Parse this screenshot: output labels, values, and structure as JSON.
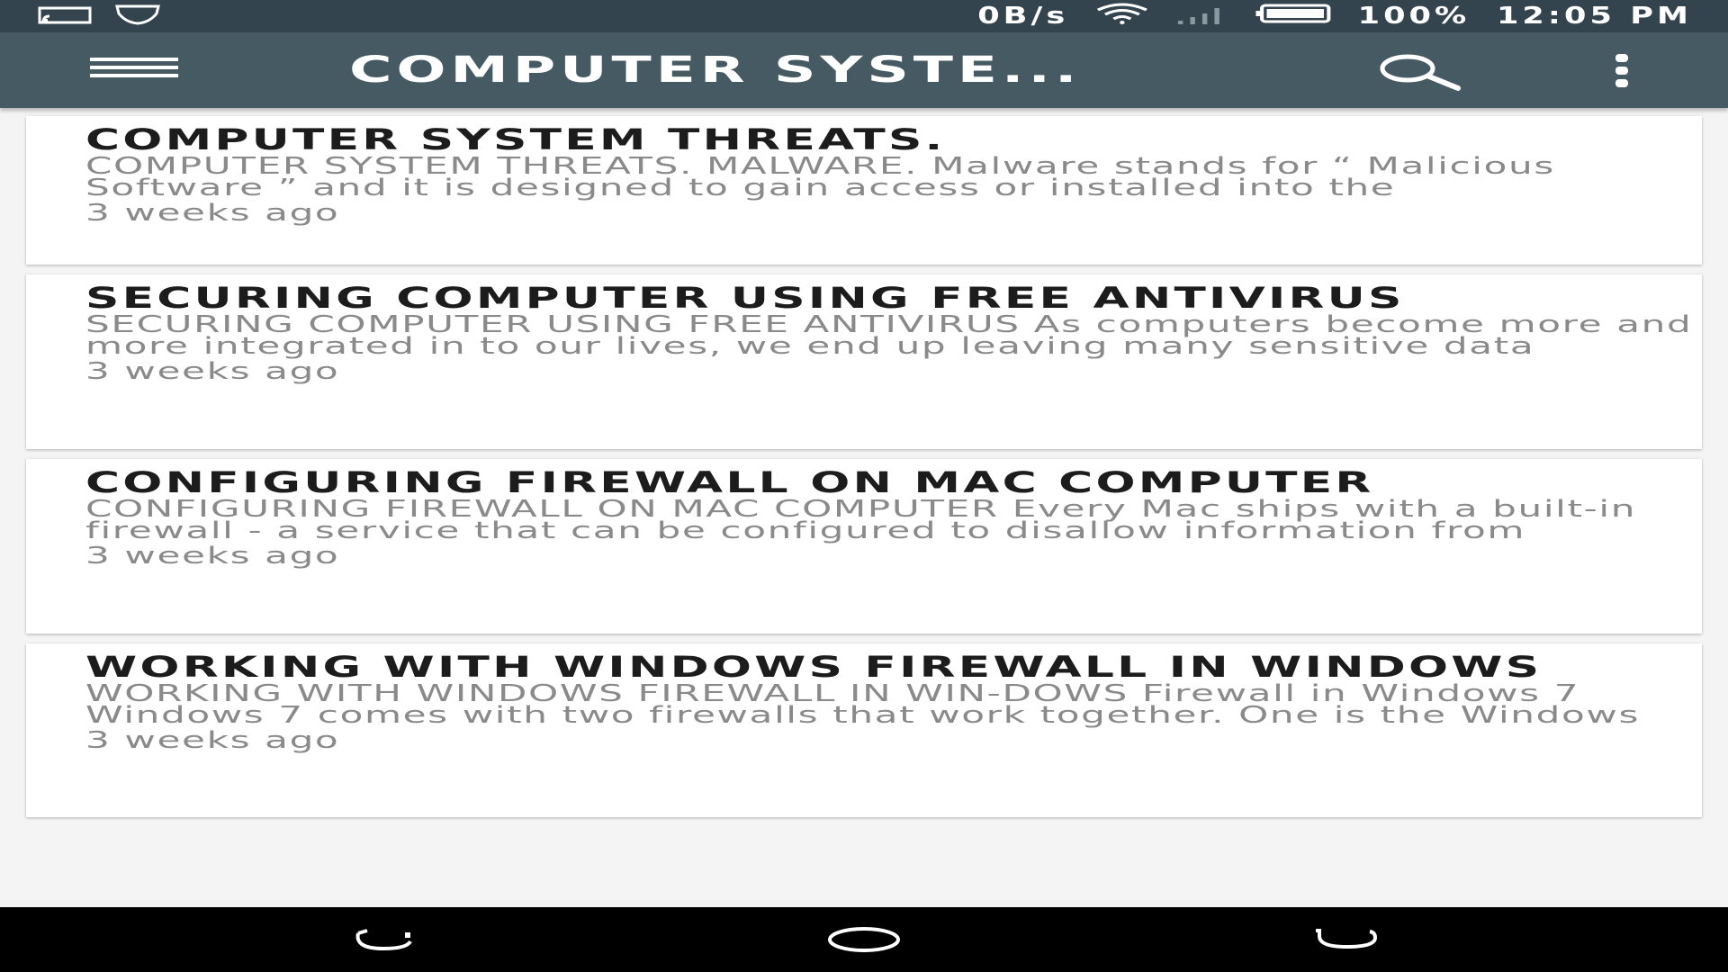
{
  "status_bar": {
    "network_speed": "0B/s",
    "battery_percent": "100%",
    "time": "12:05 PM",
    "icons": [
      "cast-icon",
      "shield-icon",
      "wifi-icon",
      "signal-icon",
      "battery-icon"
    ]
  },
  "app_bar": {
    "title": "COMPUTER SYSTE...",
    "background_color": "#465a64",
    "icons": [
      "menu-icon",
      "search-icon",
      "more-vert-icon"
    ]
  },
  "articles": [
    {
      "title": "COMPUTER SYSTEM THREATS.",
      "excerpt": "COMPUTER SYSTEM THREATS. MALWARE. Malware stands for “ Malicious Software ” and it is designed to gain access or installed into the",
      "time": "3 weeks ago"
    },
    {
      "title": "SECURING COMPUTER USING FREE ANTIVIRUS",
      "excerpt": "SECURING COMPUTER USING FREE ANTIVIRUS As computers become more and more integrated in to our lives, we end up leaving many sensitive data",
      "time": "3 weeks ago"
    },
    {
      "title": "CONFIGURING FIREWALL ON MAC COMPUTER",
      "excerpt": "CONFIGURING FIREWALL ON MAC COMPUTER Every Mac ships with a built-in firewall - a service that can be configured to disallow information from",
      "time": "3 weeks ago"
    },
    {
      "title": "WORKING WITH WINDOWS FIREWALL IN WINDOWS",
      "excerpt": "WORKING WITH WINDOWS FIREWALL IN WIN-DOWS Firewall in Windows 7 Windows 7 comes with two firewalls that work together. One is the Windows",
      "time": "3 weeks ago"
    }
  ],
  "nav_bar": {
    "icons": [
      "recent-apps-icon",
      "home-icon",
      "back-icon"
    ]
  }
}
